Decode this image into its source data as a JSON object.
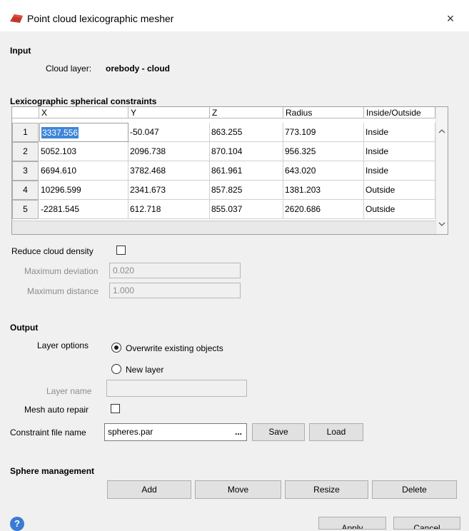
{
  "window": {
    "title": "Point cloud lexicographic mesher",
    "close_icon": "×"
  },
  "input": {
    "section_label": "Input",
    "cloud_layer_label": "Cloud layer:",
    "cloud_layer_value": "orebody - cloud"
  },
  "constraints": {
    "section_label": "Lexicographic spherical constraints",
    "columns": [
      "X",
      "Y",
      "Z",
      "Radius",
      "Inside/Outside"
    ],
    "rows": [
      {
        "n": "1",
        "x": "3337.556",
        "y": "-50.047",
        "z": "863.255",
        "r": "773.109",
        "io": "Inside"
      },
      {
        "n": "2",
        "x": "5052.103",
        "y": "2096.738",
        "z": "870.104",
        "r": "956.325",
        "io": "Inside"
      },
      {
        "n": "3",
        "x": "6694.610",
        "y": "3782.468",
        "z": "861.961",
        "r": "643.020",
        "io": "Inside"
      },
      {
        "n": "4",
        "x": "10296.599",
        "y": "2341.673",
        "z": "857.825",
        "r": "1381.203",
        "io": "Outside"
      },
      {
        "n": "5",
        "x": "-2281.545",
        "y": "612.718",
        "z": "855.037",
        "r": "2620.686",
        "io": "Outside"
      }
    ]
  },
  "density": {
    "reduce_label": "Reduce cloud density",
    "max_dev_label": "Maximum deviation",
    "max_dev_value": "0.020",
    "max_dist_label": "Maximum distance",
    "max_dist_value": "1.000"
  },
  "output": {
    "section_label": "Output",
    "layer_options_label": "Layer options",
    "overwrite_label": "Overwrite existing objects",
    "new_layer_label": "New layer",
    "layer_name_label": "Layer name",
    "layer_name_value": "",
    "mesh_repair_label": "Mesh auto repair",
    "constraint_file_label": "Constraint file name",
    "constraint_file_value": "spheres.par",
    "browse_label": "...",
    "save_label": "Save",
    "load_label": "Load"
  },
  "sphere": {
    "section_label": "Sphere management",
    "add": "Add",
    "move": "Move",
    "resize": "Resize",
    "delete": "Delete"
  },
  "footer": {
    "help_glyph": "?",
    "apply": "Apply",
    "cancel": "Cancel"
  }
}
